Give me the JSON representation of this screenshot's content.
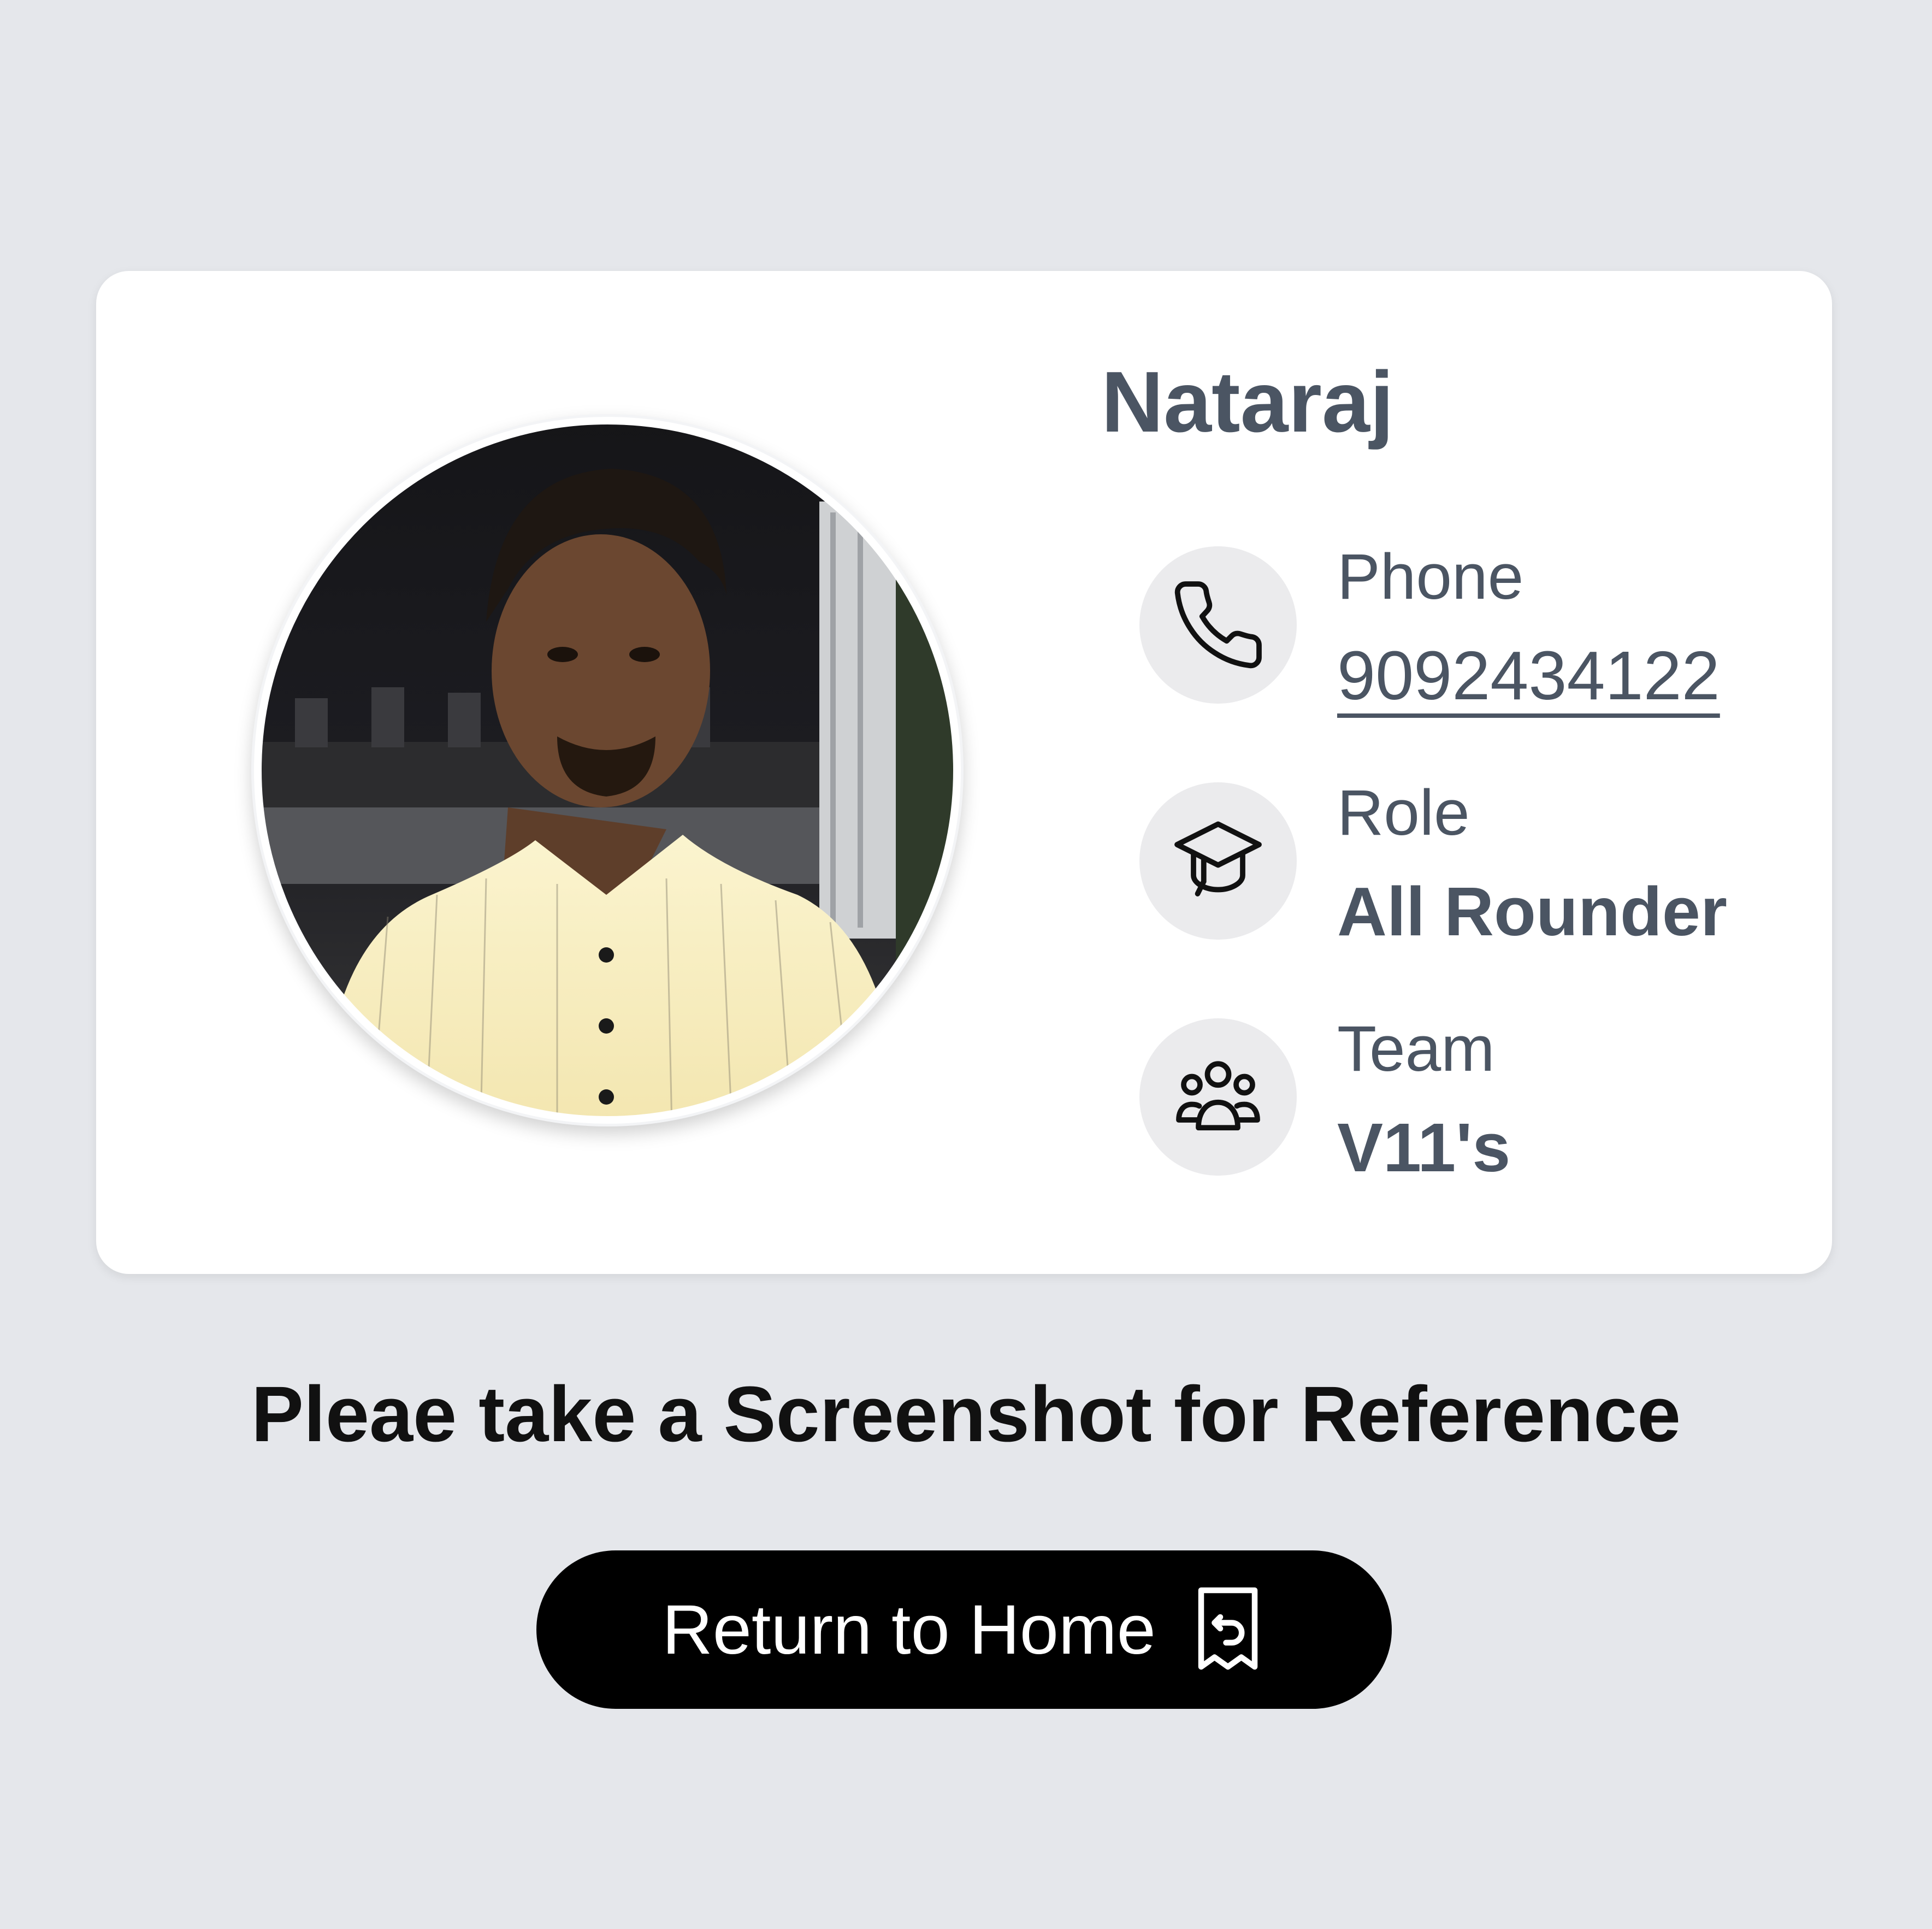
{
  "profile": {
    "name": "Nataraj",
    "photo_icon": "profile-photo",
    "fields": [
      {
        "label": "Phone",
        "value": "9092434122",
        "icon": "phone-icon"
      },
      {
        "label": "Role",
        "value": "All Rounder",
        "icon": "graduation-cap-icon"
      },
      {
        "label": "Team",
        "value": "V11's",
        "icon": "group-icon"
      }
    ]
  },
  "message": "Pleae take a Screenshot for Reference",
  "actions": {
    "home_label": "Return to Home",
    "home_icon": "receipt-return-icon"
  },
  "colors": {
    "background": "#e5e7eb",
    "card": "#ffffff",
    "text_muted": "#4b5563",
    "icon_bg": "#ebebed",
    "button": "#000000"
  }
}
